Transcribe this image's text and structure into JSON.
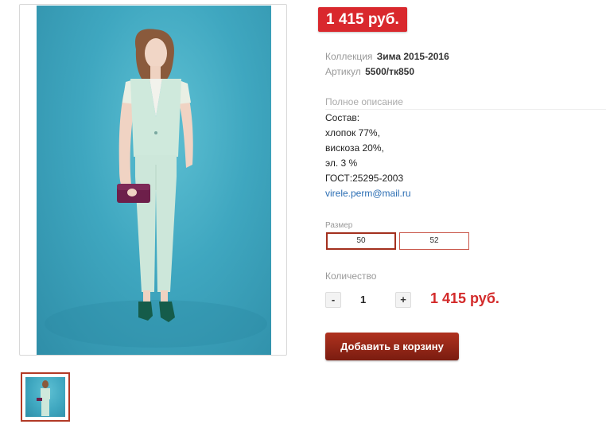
{
  "product": {
    "price_badge": "1 415 руб.",
    "image_label": "model-in-mint-suit",
    "meta": {
      "collection_label": "Коллекция",
      "collection_value": "Зима 2015-2016",
      "article_label": "Артикул",
      "article_value": "5500/тк850"
    },
    "description": {
      "title": "Полное описание",
      "lines": [
        "Состав:",
        "хлопок 77%,",
        "вискоза 20%,",
        "эл. 3 %",
        "ГОСТ:25295-2003"
      ],
      "email": "virele.perm@mail.ru"
    },
    "size": {
      "label": "Размер",
      "options": [
        "50",
        "52"
      ],
      "selected": "50"
    },
    "quantity": {
      "label": "Количество",
      "minus": "-",
      "value": "1",
      "plus": "+"
    },
    "total_price": "1 415 руб.",
    "add_to_cart": "Добавить в корзину"
  },
  "colors": {
    "price_red": "#d9282d",
    "button_dark_red": "#8c2214",
    "link_blue": "#2a6db3",
    "photo_background": "#3fa7c0"
  }
}
